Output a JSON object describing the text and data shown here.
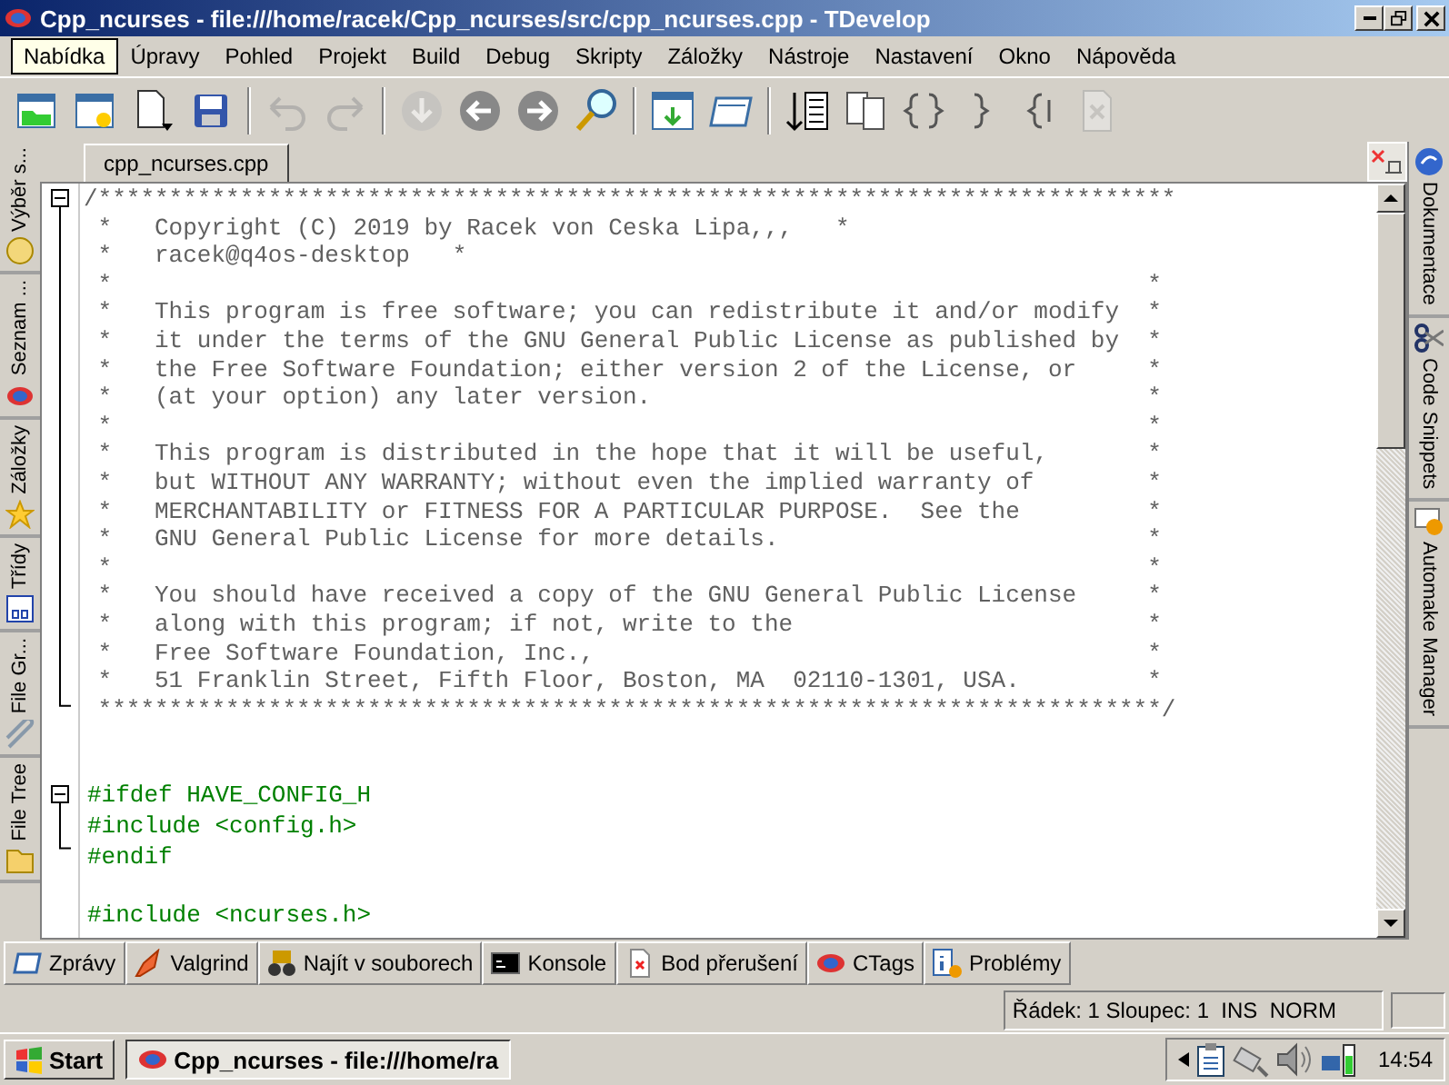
{
  "window": {
    "title": "Cpp_ncurses - file:///home/racek/Cpp_ncurses/src/cpp_ncurses.cpp - TDevelop"
  },
  "menu": [
    {
      "label": "Nabídka",
      "selected": true
    },
    {
      "label": "Úpravy",
      "selected": false
    },
    {
      "label": "Pohled",
      "selected": false
    },
    {
      "label": "Projekt",
      "selected": false
    },
    {
      "label": "Build",
      "selected": false
    },
    {
      "label": "Debug",
      "selected": false
    },
    {
      "label": "Skripty",
      "selected": false
    },
    {
      "label": "Záložky",
      "selected": false
    },
    {
      "label": "Nástroje",
      "selected": false
    },
    {
      "label": "Nastavení",
      "selected": false
    },
    {
      "label": "Okno",
      "selected": false
    },
    {
      "label": "Nápověda",
      "selected": false
    }
  ],
  "toolbar": [
    {
      "kind": "folder-open",
      "disabled": false
    },
    {
      "kind": "new-project",
      "disabled": false
    },
    {
      "kind": "new-file",
      "disabled": false
    },
    {
      "kind": "save",
      "disabled": false
    },
    {
      "kind": "sep"
    },
    {
      "kind": "undo",
      "disabled": true
    },
    {
      "kind": "redo",
      "disabled": true
    },
    {
      "kind": "sep"
    },
    {
      "kind": "down",
      "disabled": true
    },
    {
      "kind": "back",
      "disabled": false
    },
    {
      "kind": "forward",
      "disabled": false
    },
    {
      "kind": "find",
      "disabled": false
    },
    {
      "kind": "sep"
    },
    {
      "kind": "window-down",
      "disabled": false
    },
    {
      "kind": "window",
      "disabled": false
    },
    {
      "kind": "sep"
    },
    {
      "kind": "sort",
      "disabled": false
    },
    {
      "kind": "copy",
      "disabled": false
    },
    {
      "kind": "brace",
      "disabled": false
    },
    {
      "kind": "brace-right",
      "disabled": false
    },
    {
      "kind": "brace-left",
      "disabled": false
    },
    {
      "kind": "close-doc",
      "disabled": true
    }
  ],
  "left_tabs": [
    {
      "label": "Výběr s..."
    },
    {
      "label": "Seznam ..."
    },
    {
      "label": "Záložky"
    },
    {
      "label": "Třídy"
    },
    {
      "label": "File Gr..."
    },
    {
      "label": "File Tree"
    }
  ],
  "right_tabs": [
    {
      "label": "Dokumentace"
    },
    {
      "label": "Code Snippets"
    },
    {
      "label": "Automake Manager"
    }
  ],
  "editor_tabs": [
    {
      "label": "cpp_ncurses.cpp",
      "selected": true
    }
  ],
  "code": [
    {
      "kind": "comment",
      "text": "/****************************************************************************",
      "children": [
        {
          "kind": "comment",
          "text": " *   Copyright (C) 2019 by Racek von Ceska Lipa,,,   *"
        },
        {
          "kind": "comment",
          "text": " *   racek@q4os-desktop   *"
        },
        {
          "kind": "comment",
          "text": " *                                                                         *"
        },
        {
          "kind": "comment",
          "text": " *   This program is free software; you can redistribute it and/or modify  *"
        },
        {
          "kind": "comment",
          "text": " *   it under the terms of the GNU General Public License as published by  *"
        },
        {
          "kind": "comment",
          "text": " *   the Free Software Foundation; either version 2 of the License, or     *"
        },
        {
          "kind": "comment",
          "text": " *   (at your option) any later version.                                   *"
        },
        {
          "kind": "comment",
          "text": " *                                                                         *"
        },
        {
          "kind": "comment",
          "text": " *   This program is distributed in the hope that it will be useful,       *"
        },
        {
          "kind": "comment",
          "text": " *   but WITHOUT ANY WARRANTY; without even the implied warranty of        *"
        },
        {
          "kind": "comment",
          "text": " *   MERCHANTABILITY or FITNESS FOR A PARTICULAR PURPOSE.  See the         *"
        },
        {
          "kind": "comment",
          "text": " *   GNU General Public License for more details.                          *"
        },
        {
          "kind": "comment",
          "text": " *                                                                         *"
        },
        {
          "kind": "comment",
          "text": " *   You should have received a copy of the GNU General Public License     *"
        },
        {
          "kind": "comment",
          "text": " *   along with this program; if not, write to the                         *"
        },
        {
          "kind": "comment",
          "text": " *   Free Software Foundation, Inc.,                                       *"
        },
        {
          "kind": "comment",
          "text": " *   51 Franklin Street, Fifth Floor, Boston, MA  02110-1301, USA.         *"
        },
        {
          "kind": "comment",
          "text": " ***************************************************************************/"
        }
      ]
    },
    {
      "kind": "blank"
    },
    {
      "kind": "blank"
    },
    {
      "kind": "code",
      "text": "#ifdef HAVE_CONFIG_H",
      "children": [
        {
          "kind": "code",
          "text": "#include <config.h>"
        },
        {
          "kind": "code",
          "text": "#endif"
        }
      ]
    },
    {
      "kind": "blank"
    },
    {
      "kind": "code",
      "text": "#include <ncurses.h>"
    }
  ],
  "output_tabs": [
    {
      "label": "Zprávy"
    },
    {
      "label": "Valgrind"
    },
    {
      "label": "Najít v souborech"
    },
    {
      "label": "Konsole"
    },
    {
      "label": "Bod přerušení"
    },
    {
      "label": "CTags"
    },
    {
      "label": "Problémy"
    }
  ],
  "status_bar": {
    "text": "Řádek: 1 Sloupec: 1  INS  NORM"
  },
  "taskbar": {
    "start": "Start",
    "task": "Cpp_ncurses - file:///home/ra",
    "clock": "14:54"
  }
}
